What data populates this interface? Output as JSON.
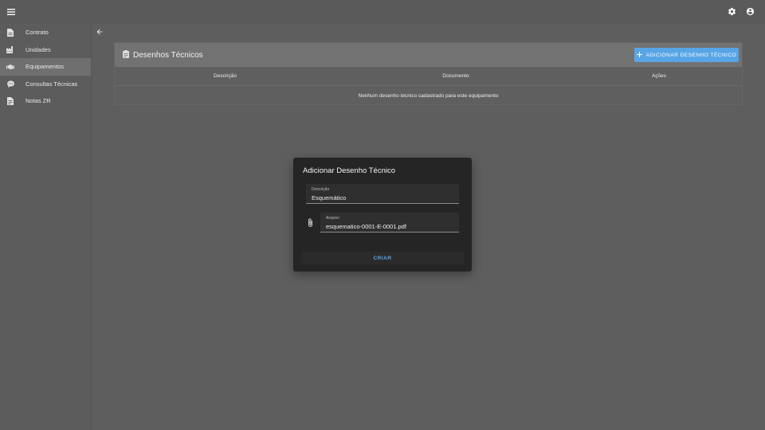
{
  "topbar": {
    "menu_icon": "menu-icon",
    "settings_icon": "gear-icon",
    "account_icon": "account-circle-icon"
  },
  "sidebar": {
    "items": [
      {
        "label": "Contrato",
        "icon": "document-icon",
        "active": false
      },
      {
        "label": "Unidades",
        "icon": "factory-icon",
        "active": false
      },
      {
        "label": "Equipamentos",
        "icon": "engine-icon",
        "active": true
      },
      {
        "label": "Consultas Técnicas",
        "icon": "chat-bubble-icon",
        "active": false
      },
      {
        "label": "Notas ZR",
        "icon": "note-icon",
        "active": false
      }
    ]
  },
  "main": {
    "back_icon": "arrow-left-icon",
    "card": {
      "title": "Desenhos Técnicos",
      "add_button_label": "ADICIONAR DESENHO TÉCNICO",
      "columns": [
        "Descrição",
        "Documento",
        "Ações"
      ],
      "empty_message": "Nenhum desenho técnico cadastrado para este equipamento"
    }
  },
  "dialog": {
    "title": "Adicionar Desenho Técnico",
    "descricao_label": "Descrição",
    "descricao_value": "Esquemático",
    "arquivo_label": "Arquivo",
    "arquivo_value": "esquematico-0001-E-0001.pdf",
    "submit_label": "CRIAR"
  },
  "colors": {
    "accent": "#58a5e6",
    "dialog_bg": "#252525",
    "background": "#5e5e5e"
  }
}
